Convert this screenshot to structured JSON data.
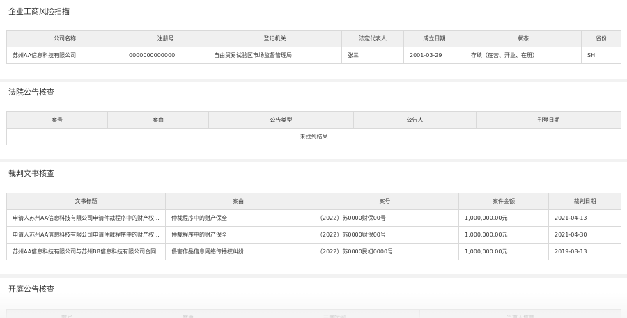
{
  "sections": {
    "business": {
      "title": "企业工商风险扫描",
      "headers": [
        "公司名称",
        "注册号",
        "登记机关",
        "法定代表人",
        "成立日期",
        "状态",
        "省份"
      ],
      "rows": [
        [
          "苏州AA信息科技有限公司",
          "0000000000000",
          "自由贸易试验区市场监督管理局",
          "张三",
          "2001-03-29",
          "存续（在营、开业、在册）",
          "SH"
        ]
      ]
    },
    "court": {
      "title": "法院公告核查",
      "headers": [
        "案号",
        "案由",
        "公告类型",
        "公告人",
        "刊登日期"
      ],
      "empty_text": "未找到结果"
    },
    "judgment": {
      "title": "裁判文书核查",
      "headers": [
        "文书标题",
        "案由",
        "案号",
        "案件金额",
        "裁判日期"
      ],
      "rows": [
        [
          "申请人苏州AA信息科技有限公司申请仲裁程序中的财产权...",
          "仲裁程序中的财产保全",
          "（2022）苏0000财保00号",
          "1,000,000.00元",
          "2021-04-13"
        ],
        [
          "申请人苏州AA信息科技有限公司申请仲裁程序中的财产权...",
          "仲裁程序中的财产保全",
          "（2022）苏0000财保00号",
          "1,000,000.00元",
          "2021-04-30"
        ],
        [
          "苏州AA信息科技有限公司与苏州BB信息科技有限公司合同...",
          "侵害作品信息网络传播权纠纷",
          "（2022）苏0000民初0000号",
          "1,000,000.00元",
          "2019-08-13"
        ]
      ]
    },
    "hearing": {
      "title": "开庭公告核查",
      "headers": [
        "案号",
        "案由",
        "开庭时间",
        "当事人信息"
      ]
    }
  }
}
